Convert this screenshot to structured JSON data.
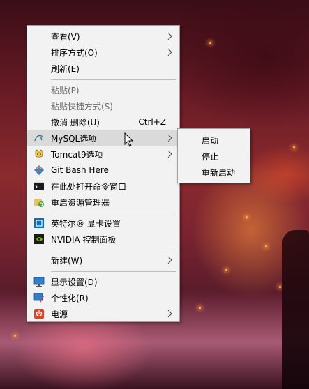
{
  "context_menu": {
    "items": [
      {
        "label": "查看(V)",
        "has_submenu": true
      },
      {
        "label": "排序方式(O)",
        "has_submenu": true
      },
      {
        "label": "刷新(E)"
      },
      {
        "label": "粘贴(P)",
        "disabled": true
      },
      {
        "label": "粘贴快捷方式(S)",
        "disabled": true
      },
      {
        "label": "撤消 删除(U)",
        "shortcut": "Ctrl+Z"
      },
      {
        "label": "MySQL选项",
        "icon": "mysql-icon",
        "has_submenu": true,
        "highlighted": true
      },
      {
        "label": "Tomcat9选项",
        "icon": "tomcat-icon",
        "has_submenu": true
      },
      {
        "label": "Git Bash Here",
        "icon": "git-bash-icon"
      },
      {
        "label": "在此处打开命令窗口",
        "icon": "command-prompt-icon"
      },
      {
        "label": "重启资源管理器",
        "icon": "restart-explorer-icon"
      },
      {
        "label": "英特尔® 显卡设置",
        "icon": "intel-graphics-icon"
      },
      {
        "label": "NVIDIA 控制面板",
        "icon": "nvidia-icon"
      },
      {
        "label": "新建(W)",
        "has_submenu": true
      },
      {
        "label": "显示设置(D)",
        "icon": "display-settings-icon"
      },
      {
        "label": "个性化(R)",
        "icon": "personalize-icon"
      },
      {
        "label": "电源",
        "icon": "power-icon",
        "has_submenu": true
      }
    ]
  },
  "mysql_submenu": {
    "items": [
      {
        "label": "启动"
      },
      {
        "label": "停止"
      },
      {
        "label": "重新启动"
      }
    ]
  },
  "colors": {
    "menu_bg": "#f2f2f2",
    "hover_bg": "#dadada",
    "disabled_text": "#6d6d6d",
    "border": "#a0a0a0"
  }
}
